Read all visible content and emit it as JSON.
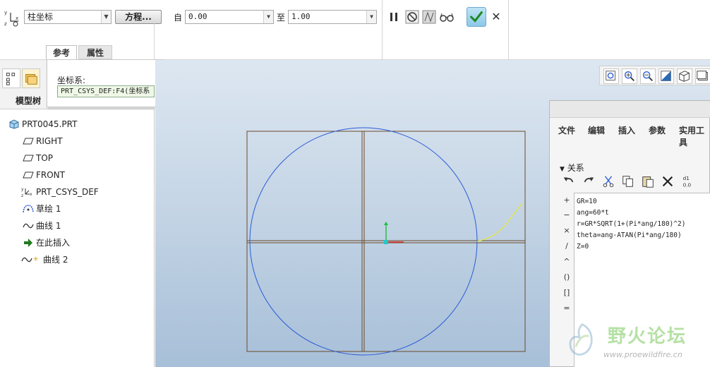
{
  "dashboard": {
    "csys_type": "柱坐标",
    "equation_button": "方程...",
    "from_label": "自",
    "from_value": "0.00",
    "to_label": "至",
    "to_value": "1.00",
    "tabs": [
      "参考",
      "属性"
    ]
  },
  "reference_panel": {
    "label": "坐标系:",
    "value": "PRT_CSYS_DEF:F4(坐标系"
  },
  "left_panel": {
    "tab_label": "模型树",
    "tree": [
      {
        "label": "PRT0045.PRT",
        "icon": "part-icon"
      },
      {
        "label": "RIGHT",
        "icon": "datum-plane-icon"
      },
      {
        "label": "TOP",
        "icon": "datum-plane-icon"
      },
      {
        "label": "FRONT",
        "icon": "datum-plane-icon"
      },
      {
        "label": "PRT_CSYS_DEF",
        "icon": "csys-icon"
      },
      {
        "label": "草绘 1",
        "icon": "sketch-icon"
      },
      {
        "label": "曲线 1",
        "icon": "curve-icon"
      },
      {
        "label": "在此插入",
        "icon": "insert-here-arrow-icon"
      },
      {
        "label": "曲线 2",
        "icon": "curve-new-icon"
      }
    ]
  },
  "relations": {
    "menu": [
      "文件",
      "编辑",
      "插入",
      "参数",
      "实用工具"
    ],
    "section": "关系",
    "lines": [
      "GR=10",
      "ang=60*t",
      "r=GR*SQRT(1+(Pi*ang/180)^2)",
      "theta=ang-ATAN(Pi*ang/180)",
      "Z=0"
    ],
    "operators": [
      "+",
      "−",
      "×",
      "/",
      "^",
      "()",
      "[]",
      "="
    ]
  },
  "watermark": {
    "title": "野火论坛",
    "url": "www.proewildfire.cn"
  },
  "colors": {
    "circle": "#2a5bd7",
    "involute_curve": "#e8e83a",
    "sketch_frame": "#6b4a2a",
    "ok_check": "#2a8a2a"
  }
}
